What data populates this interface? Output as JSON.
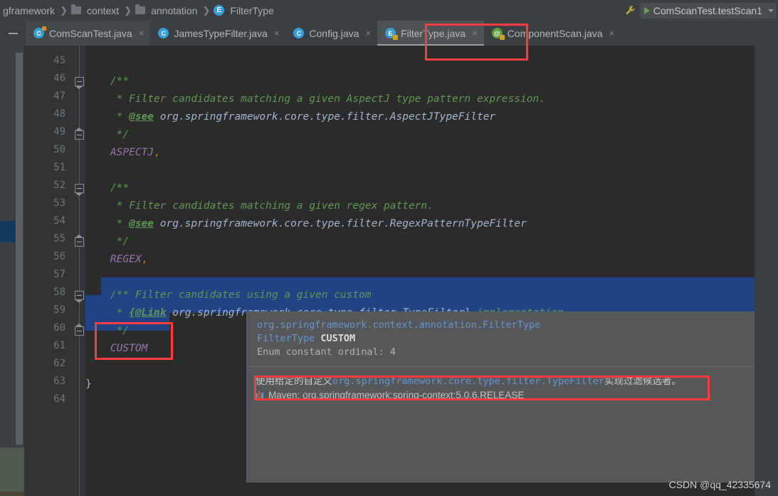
{
  "breadcrumb": {
    "items": [
      {
        "label": "gframework",
        "icon": "none"
      },
      {
        "label": "context",
        "icon": "folder-icon"
      },
      {
        "label": "annotation",
        "icon": "folder-icon"
      },
      {
        "label": "FilterType",
        "icon": "enum-icon"
      }
    ]
  },
  "toolbar": {
    "wrench_icon": "wrench-icon",
    "run_config": "ComScanTest.testScan1",
    "run_icon": "play-icon",
    "dropdown_icon": "chevron-down-icon"
  },
  "tabs": {
    "collapse_label": "collapse-all",
    "items": [
      {
        "label": "ComScanTest.java",
        "icon": "class-icon",
        "badge": "run",
        "active": false,
        "close": "×"
      },
      {
        "label": "JamesTypeFilter.java",
        "icon": "class-icon",
        "badge": "none",
        "active": false,
        "close": "×"
      },
      {
        "label": "Config.java",
        "icon": "class-icon",
        "badge": "none",
        "active": false,
        "close": "×"
      },
      {
        "label": "FilterType.java",
        "icon": "enum-icon",
        "badge": "lock",
        "active": true,
        "close": "×"
      },
      {
        "label": "ComponentScan.java",
        "icon": "annotation-icon",
        "badge": "lock",
        "active": false,
        "close": "×"
      }
    ]
  },
  "editor": {
    "first_line": 45,
    "last_line": 64,
    "line_numbers": [
      45,
      46,
      47,
      48,
      49,
      50,
      51,
      52,
      53,
      54,
      55,
      56,
      57,
      58,
      59,
      60,
      61,
      62,
      63,
      64
    ],
    "current_line": 59,
    "selected_lines": [
      58,
      59
    ],
    "lines": [
      {
        "n": 45,
        "segments": []
      },
      {
        "n": 46,
        "segments": [
          {
            "t": "    /**",
            "c": "cmt"
          }
        ]
      },
      {
        "n": 47,
        "segments": [
          {
            "t": "     * Filter candidates matching a given AspectJ type pattern expression.",
            "c": "cmt"
          }
        ]
      },
      {
        "n": 48,
        "segments": [
          {
            "t": "     * ",
            "c": "cmt"
          },
          {
            "t": "@see",
            "c": "tag"
          },
          {
            "t": " org.springframework.core.type.filter.AspectJTypeFilter",
            "c": "link"
          }
        ]
      },
      {
        "n": 49,
        "segments": [
          {
            "t": "     */",
            "c": "cmt"
          }
        ]
      },
      {
        "n": 50,
        "segments": [
          {
            "t": "    ASPECTJ",
            "c": "enumc"
          },
          {
            "t": ",",
            "c": "punc"
          }
        ]
      },
      {
        "n": 51,
        "segments": []
      },
      {
        "n": 52,
        "segments": [
          {
            "t": "    /**",
            "c": "cmt"
          }
        ]
      },
      {
        "n": 53,
        "segments": [
          {
            "t": "     * Filter candidates matching a given regex pattern.",
            "c": "cmt"
          }
        ]
      },
      {
        "n": 54,
        "segments": [
          {
            "t": "     * ",
            "c": "cmt"
          },
          {
            "t": "@see",
            "c": "tag"
          },
          {
            "t": " org.springframework.core.type.filter.RegexPatternTypeFilter",
            "c": "link"
          }
        ]
      },
      {
        "n": 55,
        "segments": [
          {
            "t": "     */",
            "c": "cmt"
          }
        ]
      },
      {
        "n": 56,
        "segments": [
          {
            "t": "    REGEX",
            "c": "enumc"
          },
          {
            "t": ",",
            "c": "punc"
          }
        ]
      },
      {
        "n": 57,
        "segments": []
      },
      {
        "n": 58,
        "segments": [
          {
            "t": "    /** Filter candidates using a given custom",
            "c": "cmt"
          }
        ]
      },
      {
        "n": 59,
        "segments": [
          {
            "t": "     * ",
            "c": "cmt"
          },
          {
            "t": "{@Link",
            "c": "tag"
          },
          {
            "t": " org.springframework.core.type.filter.TypeFilter}",
            "c": "link"
          },
          {
            "t": " implementation.",
            "c": "cmt"
          }
        ]
      },
      {
        "n": 60,
        "segments": [
          {
            "t": "     */",
            "c": "cmt"
          }
        ]
      },
      {
        "n": 61,
        "segments": [
          {
            "t": "    CUSTOM",
            "c": "enumc"
          }
        ]
      },
      {
        "n": 62,
        "segments": []
      },
      {
        "n": 63,
        "segments": [
          {
            "t": "}",
            "c": "brace"
          }
        ]
      },
      {
        "n": 64,
        "segments": []
      }
    ]
  },
  "documentation": {
    "qualified_name": "org.springframework.context.annotation.FilterType",
    "declaration_owner": "FilterType",
    "declaration_member": "CUSTOM",
    "ordinal_text": "Enum constant ordinal: 4",
    "description_prefix": "使用给定的自定义",
    "description_code": "org.springframework.core.type.filter.TypeFilter",
    "description_suffix": "实现过滤候选者。",
    "library": "Maven: org.springframework:spring-context:5.0.6.RELEASE",
    "library_icon": "maven-icon"
  },
  "annotations": {
    "highlight_color": "#fa3c3c",
    "boxes": [
      "filtertype-tab-box",
      "custom-constant-box",
      "chinese-doc-box"
    ]
  },
  "watermark": "CSDN @qq_42335674"
}
